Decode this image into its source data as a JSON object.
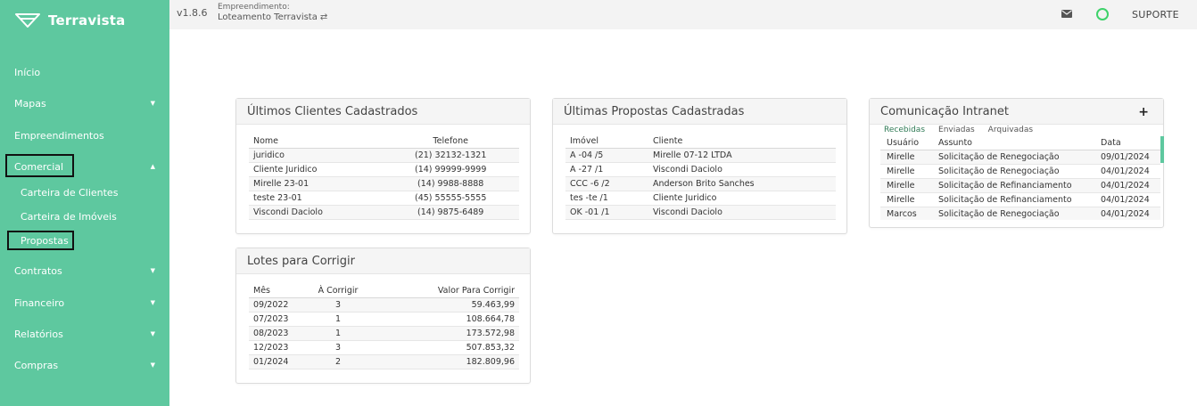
{
  "app": {
    "name": "Terravista",
    "version": "v1.8.6",
    "accent_color": "#5ec89f",
    "logo_icon": "terravista-logo-icon"
  },
  "header": {
    "empreendimento_caption": "Empreendimento:",
    "empreendimento_name": "Loteamento Terravista",
    "swap_icon": "⇄",
    "mail_icon": "mail-icon",
    "status_icon": "status-circle-icon",
    "support_label": "SUPORTE"
  },
  "sidebar": {
    "items": [
      {
        "label": "Início",
        "caret": ""
      },
      {
        "label": "Mapas",
        "caret": "▼"
      },
      {
        "label": "Empreendimentos",
        "caret": ""
      },
      {
        "label": "Comercial",
        "caret": "▲"
      },
      {
        "label": "Carteira de Clientes",
        "caret": ""
      },
      {
        "label": "Carteira de Imóveis",
        "caret": ""
      },
      {
        "label": "Propostas",
        "caret": ""
      },
      {
        "label": "Contratos",
        "caret": "▼"
      },
      {
        "label": "Financeiro",
        "caret": "▼"
      },
      {
        "label": "Relatórios",
        "caret": "▼"
      },
      {
        "label": "Compras",
        "caret": "▼"
      }
    ]
  },
  "clientes": {
    "title": "Últimos Clientes Cadastrados",
    "headers": [
      "Nome",
      "Telefone"
    ],
    "rows": [
      [
        "juridico",
        "(21) 32132-1321"
      ],
      [
        "Cliente Juridico",
        "(14) 99999-9999"
      ],
      [
        "Mirelle 23-01",
        "(14) 9988-8888"
      ],
      [
        "teste 23-01",
        "(45) 55555-5555"
      ],
      [
        "Viscondi Daciolo",
        "(14) 9875-6489"
      ]
    ]
  },
  "propostas": {
    "title": "Últimas Propostas Cadastradas",
    "headers": [
      "Imóvel",
      "Cliente"
    ],
    "rows": [
      [
        "A -04 /5",
        "Mirelle 07-12 LTDA"
      ],
      [
        "A -27 /1",
        "Viscondi Daciolo"
      ],
      [
        "CCC -6 /2",
        "Anderson Brito Sanches"
      ],
      [
        "tes -te /1",
        "Cliente Juridico"
      ],
      [
        "OK -01 /1",
        "Viscondi Daciolo"
      ]
    ]
  },
  "intranet": {
    "title": "Comunicação Intranet",
    "add_label": "+",
    "tabs": [
      "Recebidas",
      "Enviadas",
      "Arquivadas"
    ],
    "headers": [
      "Usuário",
      "Assunto",
      "Data"
    ],
    "rows": [
      [
        "Mirelle",
        "Solicitação de Renegociação",
        "09/01/2024"
      ],
      [
        "Mirelle",
        "Solicitação de Renegociação",
        "04/01/2024"
      ],
      [
        "Mirelle",
        "Solicitação de Refinanciamento",
        "04/01/2024"
      ],
      [
        "Mirelle",
        "Solicitação de Refinanciamento",
        "04/01/2024"
      ],
      [
        "Marcos",
        "Solicitação de Renegociação",
        "04/01/2024"
      ]
    ]
  },
  "lotes": {
    "title": "Lotes para Corrigir",
    "headers": [
      "Mês",
      "À Corrigir",
      "Valor Para Corrigir"
    ],
    "rows": [
      [
        "09/2022",
        "3",
        "59.463,99"
      ],
      [
        "07/2023",
        "1",
        "108.664,78"
      ],
      [
        "08/2023",
        "1",
        "173.572,98"
      ],
      [
        "12/2023",
        "3",
        "507.853,32"
      ],
      [
        "01/2024",
        "2",
        "182.809,96"
      ]
    ]
  }
}
